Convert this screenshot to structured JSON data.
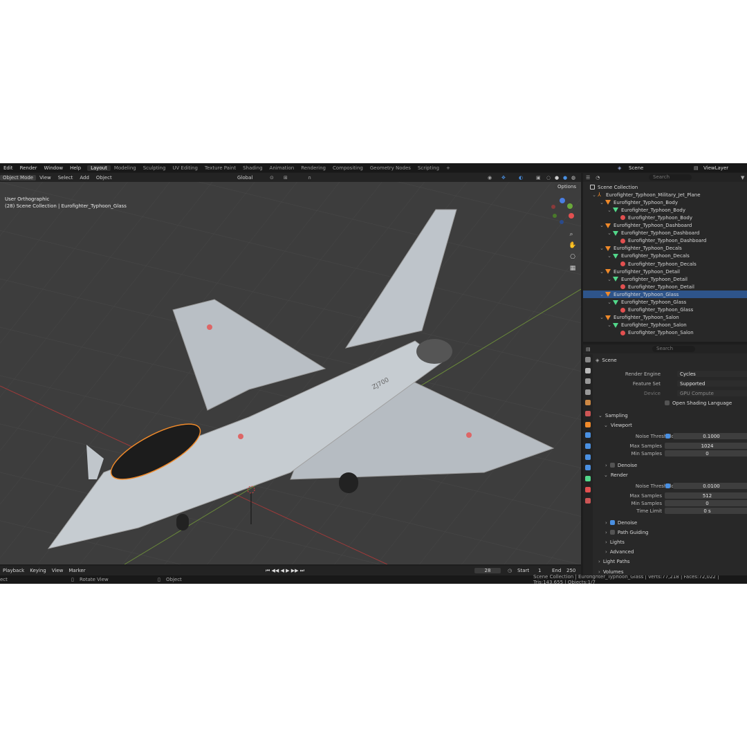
{
  "menubar": {
    "items": [
      "Edit",
      "Render",
      "Window",
      "Help"
    ],
    "workspaces": [
      "Layout",
      "Modeling",
      "Sculpting",
      "UV Editing",
      "Texture Paint",
      "Shading",
      "Animation",
      "Rendering",
      "Compositing",
      "Geometry Nodes",
      "Scripting",
      "+"
    ],
    "active_workspace": "Layout",
    "scene_label": "Scene",
    "viewlayer_label": "ViewLayer"
  },
  "viewport_header": {
    "mode": "Object Mode",
    "menus": [
      "View",
      "Select",
      "Add",
      "Object"
    ],
    "transform_orientation": "Global",
    "options_label": "Options"
  },
  "viewport": {
    "view_name": "User Orthographic",
    "collection_info": "(28) Scene Collection | Eurofighter_Typhoon_Glass",
    "tail_number": "ZJ700",
    "gizmo_axes": [
      "X",
      "Y",
      "Z"
    ]
  },
  "outliner": {
    "search_placeholder": "Search",
    "rows": [
      {
        "label": "Scene Collection",
        "icon": "collection",
        "indent": 0
      },
      {
        "label": "Eurofighter_Typhoon_Military_Jet_Plane",
        "icon": "empty",
        "indent": 1
      },
      {
        "label": "Eurofighter_Typhoon_Body",
        "icon": "object",
        "indent": 2
      },
      {
        "label": "Eurofighter_Typhoon_Body",
        "icon": "mesh",
        "indent": 3
      },
      {
        "label": "Eurofighter_Typhoon_Body",
        "icon": "material",
        "indent": 4
      },
      {
        "label": "Eurofighter_Typhoon_Dashboard",
        "icon": "object",
        "indent": 2
      },
      {
        "label": "Eurofighter_Typhoon_Dashboard",
        "icon": "mesh",
        "indent": 3
      },
      {
        "label": "Eurofighter_Typhoon_Dashboard",
        "icon": "material",
        "indent": 4
      },
      {
        "label": "Eurofighter_Typhoon_Decals",
        "icon": "object",
        "indent": 2
      },
      {
        "label": "Eurofighter_Typhoon_Decals",
        "icon": "mesh",
        "indent": 3
      },
      {
        "label": "Eurofighter_Typhoon_Decals",
        "icon": "material",
        "indent": 4
      },
      {
        "label": "Eurofighter_Typhoon_Detail",
        "icon": "object",
        "indent": 2
      },
      {
        "label": "Eurofighter_Typhoon_Detail",
        "icon": "mesh",
        "indent": 3
      },
      {
        "label": "Eurofighter_Typhoon_Detail",
        "icon": "material",
        "indent": 4
      },
      {
        "label": "Eurofighter_Typhoon_Glass",
        "icon": "object",
        "indent": 2,
        "selected": true
      },
      {
        "label": "Eurofighter_Typhoon_Glass",
        "icon": "mesh",
        "indent": 3
      },
      {
        "label": "Eurofighter_Typhoon_Glass",
        "icon": "material",
        "indent": 4
      },
      {
        "label": "Eurofighter_Typhoon_Salon",
        "icon": "object",
        "indent": 2
      },
      {
        "label": "Eurofighter_Typhoon_Salon",
        "icon": "mesh",
        "indent": 3
      },
      {
        "label": "Eurofighter_Typhoon_Salon",
        "icon": "material",
        "indent": 4
      }
    ]
  },
  "properties": {
    "search_placeholder": "Search",
    "context": "Scene",
    "render_engine_label": "Render Engine",
    "render_engine": "Cycles",
    "feature_set_label": "Feature Set",
    "feature_set": "Supported",
    "device_label": "Device",
    "device": "GPU Compute",
    "osl_label": "Open Shading Language",
    "sampling_label": "Sampling",
    "viewport_label": "Viewport",
    "vp_noise_threshold_label": "Noise Threshold",
    "vp_noise_threshold": "0.1000",
    "vp_max_samples_label": "Max Samples",
    "vp_max_samples": "1024",
    "vp_min_samples_label": "Min Samples",
    "vp_min_samples": "0",
    "vp_denoise_label": "Denoise",
    "render_label": "Render",
    "r_noise_threshold_label": "Noise Threshold",
    "r_noise_threshold": "0.0100",
    "r_max_samples_label": "Max Samples",
    "r_max_samples": "512",
    "r_min_samples_label": "Min Samples",
    "r_min_samples": "0",
    "r_time_limit_label": "Time Limit",
    "r_time_limit": "0 s",
    "r_denoise_label": "Denoise",
    "path_guiding_label": "Path Guiding",
    "lights_label": "Lights",
    "advanced_label": "Advanced",
    "light_paths_label": "Light Paths",
    "volumes_label": "Volumes"
  },
  "timeline": {
    "playback_label": "Playback",
    "keying_label": "Keying",
    "view_label": "View",
    "marker_label": "Marker",
    "current_frame": "28",
    "start_label": "Start",
    "start": "1",
    "end_label": "End",
    "end": "250"
  },
  "statusbar": {
    "left_fragment": "ect",
    "rotate_label": "Rotate View",
    "object_label": "Object",
    "stats": "Scene Collection | Eurofighter_Typhoon_Glass | Verts:77,218 | Faces:72,022 | Tris:143,655 | Objects:1/7"
  },
  "colors": {
    "selection": "#2e548a",
    "accent": "#4a90e2",
    "object_icon": "#f08a2a",
    "mesh_icon": "#52d88a",
    "material_icon": "#e25050"
  }
}
